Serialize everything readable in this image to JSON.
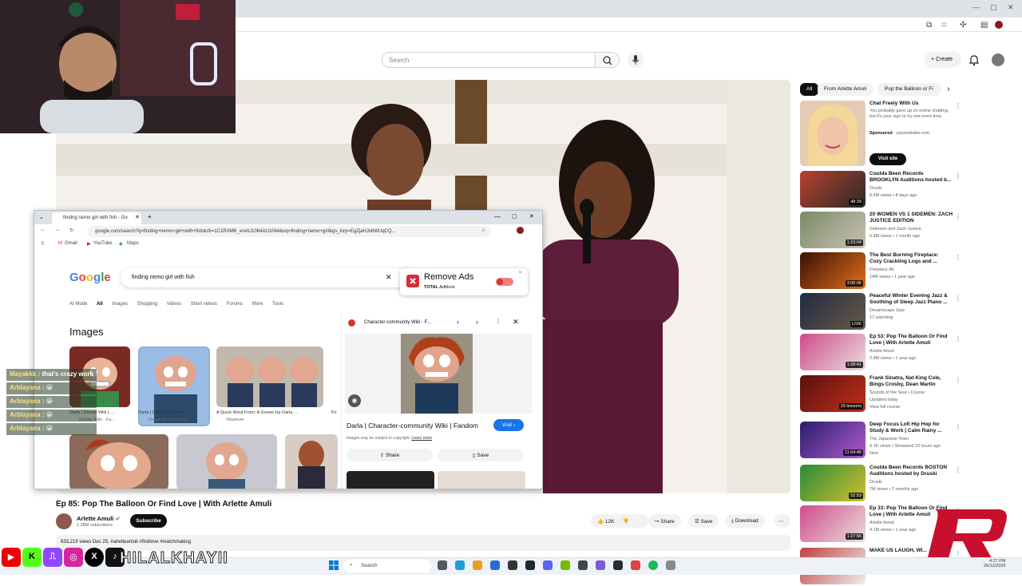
{
  "browser": {
    "window_controls": [
      "—",
      "▢",
      "✕"
    ]
  },
  "youtube": {
    "search": {
      "placeholder": "Search"
    },
    "create_label": "Create"
  },
  "overlay_window": {
    "tab_title": "finding nemo girl with fish - Go",
    "url": "google.com/search?q=finding+nemo+girl+with+fish&rlz=1C1RXMK_enAU1064AU1064&oq=finding+nemo+girl&gs_lcrp=EgZjaHJvbWUqCQ...",
    "bookmarks": [
      "Gmail",
      "YouTube",
      "Maps"
    ],
    "logo": "Google",
    "query": "finding nemo girl with fish",
    "search_tabs": [
      "AI Mode",
      "All",
      "Images",
      "Shopping",
      "Videos",
      "Short videos",
      "Forums",
      "More",
      "Tools"
    ],
    "images_title": "Images",
    "thumbs": [
      {
        "caption": "Darla | Disney Wiki | ...",
        "source": "Disney Wiki - Fa..."
      },
      {
        "caption": "Darla | Character-comm...",
        "source": "Character-communit..."
      },
      {
        "caption": "A Quick Word From: A Grown-Up Darla ...",
        "source": "Observer"
      },
      {
        "caption": "Fir",
        "source": ""
      }
    ],
    "adblock": {
      "title": "Remove Ads",
      "brand": "TOTAL",
      "sub": "Adblock"
    },
    "panel": {
      "source": "Character-community Wiki - F...",
      "title": "Darla | Character-community Wiki | Fandom",
      "visit_label": "Visit",
      "copyright": "Images may be subject to copyright.",
      "learn_more": "Learn more",
      "share_label": "Share",
      "save_label": "Save"
    }
  },
  "chat": [
    {
      "name": "Mayakkk",
      "text": "that's crazy work"
    },
    {
      "name": "Arblayana",
      "text": ""
    },
    {
      "name": "Arblayana",
      "text": ""
    },
    {
      "name": "Arblayana",
      "text": ""
    },
    {
      "name": "Arblayana",
      "text": ""
    }
  ],
  "video": {
    "title": "Ep 85: Pop The Balloon Or Find Love | With Arlette Amuli",
    "channel": "Arlette Amuli",
    "subscribers": "1.38M subscribers",
    "subscribe_label": "Subscribe",
    "likes": "12K",
    "share_label": "Share",
    "save_label": "Save",
    "download_label": "Download",
    "description": "633,219 views  Dec 25,   #arletteamuli #findlove #matchmaking"
  },
  "sidebar": {
    "chips": [
      "All",
      "From Arlette Amuli",
      "Pop the Balloon or Fi"
    ],
    "ad": {
      "title": "Chat Freely With Us",
      "desc": "You probably gave up on online chatting, but it's your sign to try one more time.",
      "sponsored": "Sponsored",
      "domain": "yourmetalks.com",
      "cta": "Visit site"
    },
    "items": [
      {
        "title": "Coulda Been Records BROOKLYN Auditions hosted b...",
        "channel": "Druski",
        "meta": "6.6M views • 8 days ago",
        "dur": "48:39",
        "c1": "#b8412e",
        "c2": "#2a2a2a"
      },
      {
        "title": "20 WOMEN VS 1 SIDEMEN: ZACH JUSTICE EDITION",
        "channel": "Sidemen and Zach Justice",
        "meta": "6.8M views • 1 month ago",
        "dur": "1:23:04",
        "c1": "#7a8a6a",
        "c2": "#c9c2b0"
      },
      {
        "title": "The Best Burning Fireplace: Cozy Crackling Logs and ...",
        "channel": "Fireplace 4K",
        "meta": "14M views • 1 year ago",
        "dur": "3:00:06",
        "c1": "#3a1004",
        "c2": "#e0701a"
      },
      {
        "title": "Peaceful Winter Evening Jazz & Soothing of Sleep Jazz Piano ...",
        "channel": "Dreamscape Jazz",
        "meta": "17 watching",
        "dur": "LIVE",
        "c1": "#1f2a44",
        "c2": "#6a5a48"
      },
      {
        "title": "Ep 53: Pop The Balloon Or Find Love | With Arlette Amuli",
        "channel": "Arlette Amuli",
        "meta": "2.8M views • 1 year ago",
        "dur": "1:28:41",
        "c1": "#d04a8a",
        "c2": "#e8e0dc"
      },
      {
        "title": "Frank Sinatra, Nat King Cole, Bings Crosby, Dean Martin",
        "channel": "Sounds of the Soul • Course",
        "meta": "Updated today",
        "extra": "View full course",
        "dur": "29 lessons",
        "c1": "#5a1010",
        "c2": "#c0301a"
      },
      {
        "title": "Deep Focus Lofi Hip Hop for Study & Work | Calm Rainy ...",
        "channel": "The Japanese Town",
        "meta": "9.1K views • Streamed 23 hours ago",
        "extra": "New",
        "dur": "11:54:45",
        "c1": "#2a1e6a",
        "c2": "#b05ad0"
      },
      {
        "title": "Coulda Been Records BOSTON Auditions hosted by Druski",
        "channel": "Druski",
        "meta": "7M views • 2 months ago",
        "dur": "52:53",
        "c1": "#2a8a3a",
        "c2": "#d0c030"
      },
      {
        "title": "Ep 33: Pop The Balloon Or Find Love | With Arlette Amuli",
        "channel": "Arlette Amuli",
        "meta": "4.1M views • 1 year ago",
        "dur": "1:27:56",
        "c1": "#d04a8a",
        "c2": "#e8e0dc"
      },
      {
        "title": "MAKE US LAUGH, WI...",
        "channel": "",
        "meta": "",
        "dur": "",
        "c1": "#c04040",
        "c2": "#eee"
      }
    ]
  },
  "stream": {
    "handle": "HILALKHAYII"
  },
  "taskbar": {
    "search_label": "Search",
    "time": "4:27 PM",
    "date": "26/12/2025",
    "lang": "ENG US"
  },
  "colors": {
    "red": "#ff0000",
    "blue": "#1a73e8",
    "brand_logo": "#c8102e"
  }
}
